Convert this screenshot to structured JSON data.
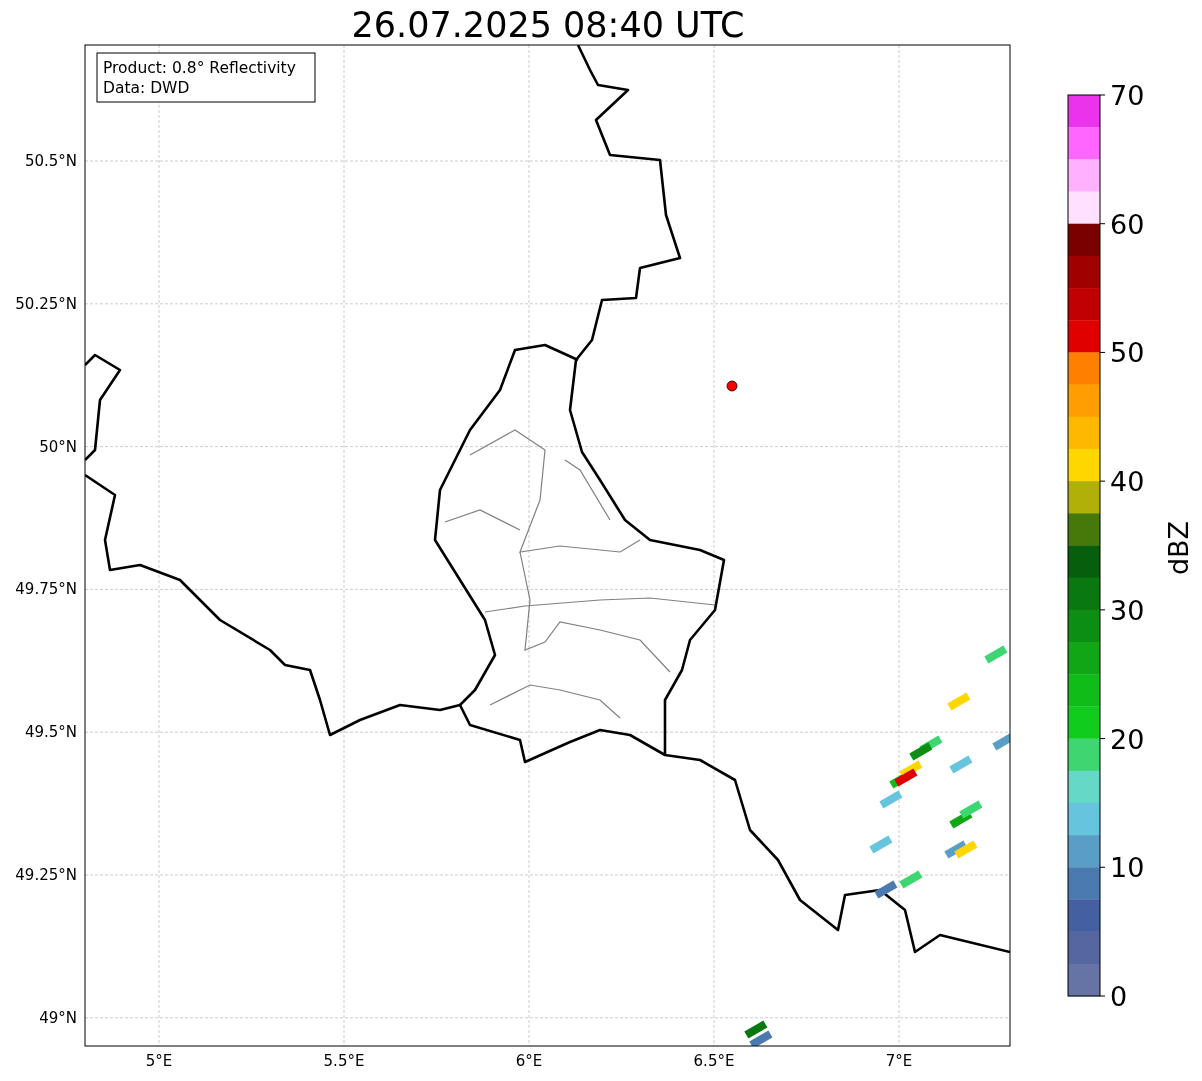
{
  "title": "26.07.2025 08:40 UTC",
  "info_box": {
    "lines": [
      "Product: 0.8° Reflectivity",
      "Data: DWD"
    ]
  },
  "map": {
    "latitude_labels": [
      "50.5°N",
      "50.25°N",
      "50°N",
      "49.75°N",
      "49.5°N",
      "49.25°N",
      "49°N"
    ],
    "longitude_labels": [
      "5°E",
      "5.5°E",
      "6°E",
      "6.5°E",
      "7°E"
    ]
  },
  "colorbar": {
    "label": "dBZ",
    "ticks": [
      "70",
      "60",
      "50",
      "40",
      "30",
      "20",
      "10",
      "0"
    ],
    "segments": [
      {
        "color": "#ea33ea"
      },
      {
        "color": "#ff66ff"
      },
      {
        "color": "#ffb0ff"
      },
      {
        "color": "#ffe0ff"
      },
      {
        "color": "#7a0000"
      },
      {
        "color": "#a00000"
      },
      {
        "color": "#c00000"
      },
      {
        "color": "#e00000"
      },
      {
        "color": "#ff8000"
      },
      {
        "color": "#ff9e00"
      },
      {
        "color": "#ffb800"
      },
      {
        "color": "#ffd700"
      },
      {
        "color": "#b0b008"
      },
      {
        "color": "#46780a"
      },
      {
        "color": "#075e0c"
      },
      {
        "color": "#0a7810"
      },
      {
        "color": "#0c8e14"
      },
      {
        "color": "#10a616"
      },
      {
        "color": "#10bc18"
      },
      {
        "color": "#10cc1c"
      },
      {
        "color": "#3dd670"
      },
      {
        "color": "#66d8c8"
      },
      {
        "color": "#66c4dc"
      },
      {
        "color": "#5a9ec6"
      },
      {
        "color": "#4a7ab0"
      },
      {
        "color": "#4460a0"
      },
      {
        "color": "#5566a0"
      },
      {
        "color": "#6573a5"
      }
    ]
  }
}
